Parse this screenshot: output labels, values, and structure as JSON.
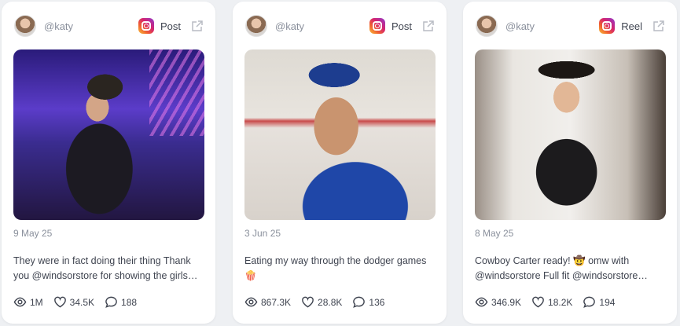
{
  "posts": [
    {
      "handle": "@katy",
      "platform_icon": "instagram-icon",
      "post_type": "Post",
      "date": "9 May 25",
      "caption": "They were in fact doing their thing Thank you @windsorstore for showing the girls…",
      "views": "1M",
      "likes": "34.5K",
      "comments": "188"
    },
    {
      "handle": "@katy",
      "platform_icon": "instagram-icon",
      "post_type": "Post",
      "date": "3 Jun 25",
      "caption": "Eating my way through the dodger games 🍿",
      "views": "867.3K",
      "likes": "28.8K",
      "comments": "136"
    },
    {
      "handle": "@katy",
      "platform_icon": "instagram-icon",
      "post_type": "Reel",
      "date": "8 May 25",
      "caption": "Cowboy Carter ready! 🤠 omw with @windsorstore Full fit @windsorstore…",
      "views": "346.9K",
      "likes": "18.2K",
      "comments": "194"
    }
  ],
  "colors": {
    "card_bg": "#ffffff",
    "page_bg": "#eef0f3",
    "muted_text": "#8a909c",
    "body_text": "#3f4450"
  }
}
